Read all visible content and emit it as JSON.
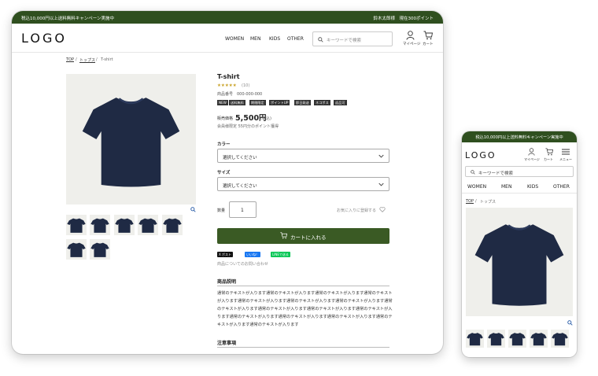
{
  "desktop": {
    "campaign": "税込10,000円以上送料無料キャンペーン実施中",
    "user_info": "鈴木太郎様　現在300ポイント",
    "logo": "LOGO",
    "nav": [
      "WOMEN",
      "MEN",
      "KIDS",
      "OTHER"
    ],
    "search_placeholder": "キーワードで検索",
    "mypage": "マイページ",
    "cart": "カート",
    "breadcrumb": [
      "TOP",
      "トップス",
      "T-shirt"
    ],
    "product": {
      "name": "T-shirt",
      "stars": "★★★★★",
      "review_count": "(10)",
      "product_no": "商品番号　000-000-000",
      "badges": [
        "NEW",
        "送料無料",
        "期間限定",
        "ポイントUP",
        "即日発送",
        "ネコポス",
        "返品可"
      ],
      "price_label": "販売価格",
      "price": "5,500円",
      "tax": "(税込)",
      "points": "会員様限定 55円分のポイント獲得",
      "color_label": "カラー",
      "color_value": "選択してください",
      "size_label": "サイズ",
      "size_value": "選択してください",
      "qty_label": "数量",
      "qty_value": "1",
      "favorite": "お気に入りに登録する",
      "cart_button": "カートに入れる",
      "share_x": "X ポスト",
      "share_fb": "いいね！",
      "share_line": "LINEで送る",
      "inquiry": "商品についてのお問い合わせ",
      "desc_title": "商品説明",
      "desc_lines": [
        "通常のテキストが入ります通常のテキストが入ります通常のテキストが入ります通常のテキスト",
        "が入ります通常のテキストが入ります通常のテキストが入ります通常のテキストが入ります通常",
        "のテキストが入ります通常のテキストが入ります通常のテキストが入ります通常のテキストが入",
        "ります通常のテキストが入ります通常のテキストが入ります通常のテキストが入ります通常のテ",
        "キストが入ります通常のテキストが入ります"
      ],
      "notes_title": "注意事項"
    }
  },
  "mobile": {
    "campaign": "税込10,000円以上送料無料キャンペーン実施中",
    "logo": "LOGO",
    "mypage": "マイページ",
    "cart": "カート",
    "menu": "メニュー",
    "search_placeholder": "キーワードで検索",
    "nav": [
      "WOMEN",
      "MEN",
      "KIDS",
      "OTHER"
    ],
    "breadcrumb": [
      "TOP",
      "トップス"
    ]
  },
  "colors": {
    "brand_green": "#2f4f1f",
    "button_green": "#3a5a24",
    "tshirt_navy": "#1f2a44",
    "x_black": "#111111",
    "fb_blue": "#1877f2",
    "line_green": "#06c755"
  },
  "icons": [
    "search-icon",
    "user-icon",
    "cart-icon",
    "menu-icon",
    "zoom-icon",
    "heart-icon",
    "chevron-down-icon"
  ]
}
